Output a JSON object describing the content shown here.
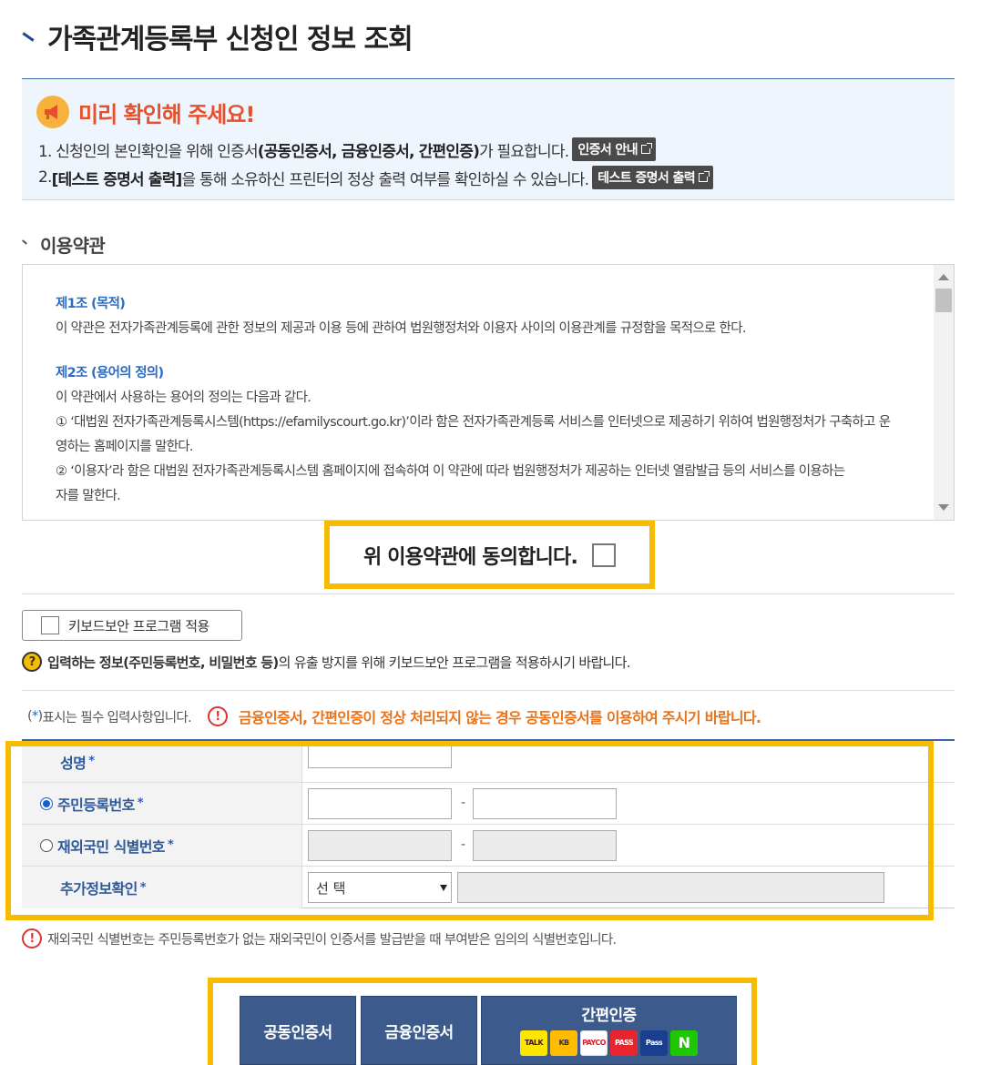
{
  "page": {
    "title": "가족관계등록부 신청인 정보 조회"
  },
  "notice": {
    "title": "미리 확인해 주세요!",
    "line1_pre": "1. 신청인의 본인확인을 위해 인증서",
    "line1_bold": "(공동인증서, 금융인증서, 간편인증)",
    "line1_post": "가 필요합니다.",
    "cert_guide_btn": "인증서 안내",
    "line2_pre": "2. ",
    "line2_bold": "[테스트 증명서 출력]",
    "line2_post": "을 통해 소유하신 프린터의 정상 출력 여부를 확인하실 수 있습니다.",
    "test_print_btn": "테스트 증명서 출력"
  },
  "terms": {
    "section_title": "이용약관",
    "art1_title": "제1조 (목적)",
    "art1_text": "이 약관은 전자가족관계등록에 관한 정보의 제공과 이용 등에 관하여 법원행정처와 이용자 사이의 이용관계를 규정함을 목적으로 한다.",
    "art2_title": "제2조 (용어의 정의)",
    "art2_text": "이 약관에서 사용하는 용어의 정의는 다음과 같다.",
    "art2_item1a": "① ‘대법원 전자가족관계등록시스템(https://efamilyscourt.go.kr)’이라 함은 전자가족관계등록 서비스를 인터넷으로 제공하기 위하여 법원행정처가 구축하고 운",
    "art2_item1b": "영하는 홈페이지를 말한다.",
    "art2_item2a": "② ‘이용자’라 함은 대법원 전자가족관계등록시스템 홈페이지에 접속하여 이 약관에 따라 법원행정처가 제공하는 인터넷 열람발급 등의 서비스를 이용하는",
    "art2_item2b": "자를 말한다.",
    "agree_label": "위 이용약관에 동의합니다."
  },
  "keyboard": {
    "button_label": "키보드보안 프로그램 적용",
    "help_icon": "?",
    "help_bold": "입력하는 정보(주민등록번호, 비밀번호 등)",
    "help_post": "의 유출 방지를 위해 키보드보안 프로그램을 적용하시기 바랍니다."
  },
  "form": {
    "required_star": "*",
    "required_open": "(",
    "required_close": ")",
    "required_note": " 표시는 필수 입력사항입니다.",
    "warn_icon": "!",
    "warning": "금융인증서, 간편인증이 정상 처리되지 않는 경우 공동인증서를 이용하여 주시기 바랍니다.",
    "name_label": "성명",
    "rrn_label": "주민등록번호",
    "foreign_label": "재외국민 식별번호",
    "extra_label": "추가정보확인",
    "dash": "-",
    "select_value": "선 택",
    "note": "재외국민 식별번호는 주민등록번호가 없는 재외국민이 인증서를 발급받을 때 부여받은 임의의 식별번호입니다."
  },
  "cert_buttons": {
    "joint": "공동인증서",
    "financial": "금융인증서",
    "simple": "간편인증",
    "logos": [
      "TALK",
      "KB",
      "PAYCO",
      "PASS",
      "Pass",
      "N"
    ]
  },
  "colors": {
    "accent_yellow": "#f5bc00",
    "navy": "#3d5a8c",
    "warning_orange": "#e8731a"
  }
}
